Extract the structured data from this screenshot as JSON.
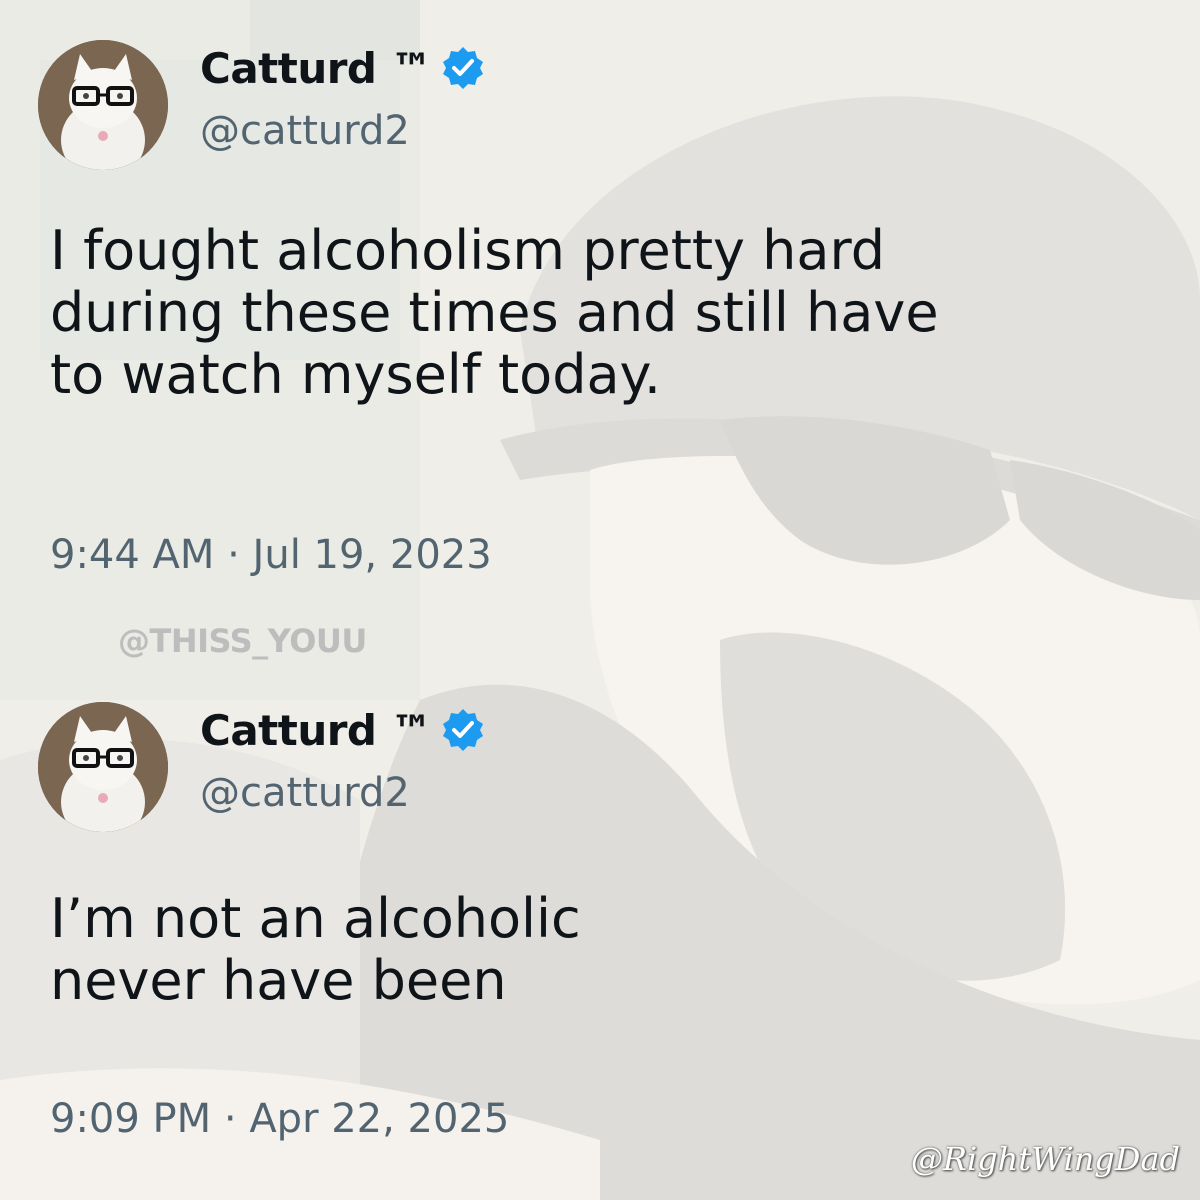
{
  "tweets": [
    {
      "display_name": "Catturd ™",
      "handle": "@catturd2",
      "text": "I fought alcoholism pretty hard\nduring these times and still have\nto watch myself today.",
      "timestamp": "9:44 AM · Jul 19, 2023",
      "avatar_icon": "cat-with-glasses-avatar",
      "verified_icon": "verified-badge-icon"
    },
    {
      "display_name": "Catturd ™",
      "handle": "@catturd2",
      "text": "I’m not an alcoholic\nnever have been",
      "timestamp": "9:09 PM · Apr 22, 2025",
      "avatar_icon": "cat-with-glasses-avatar",
      "verified_icon": "verified-badge-icon"
    }
  ],
  "watermarks": {
    "top": "@THISS_YOUU",
    "bottom": "@RightWingDad"
  },
  "colors": {
    "text_primary": "#0f1419",
    "text_secondary": "#536471",
    "verified_blue": "#1d9bf0"
  }
}
